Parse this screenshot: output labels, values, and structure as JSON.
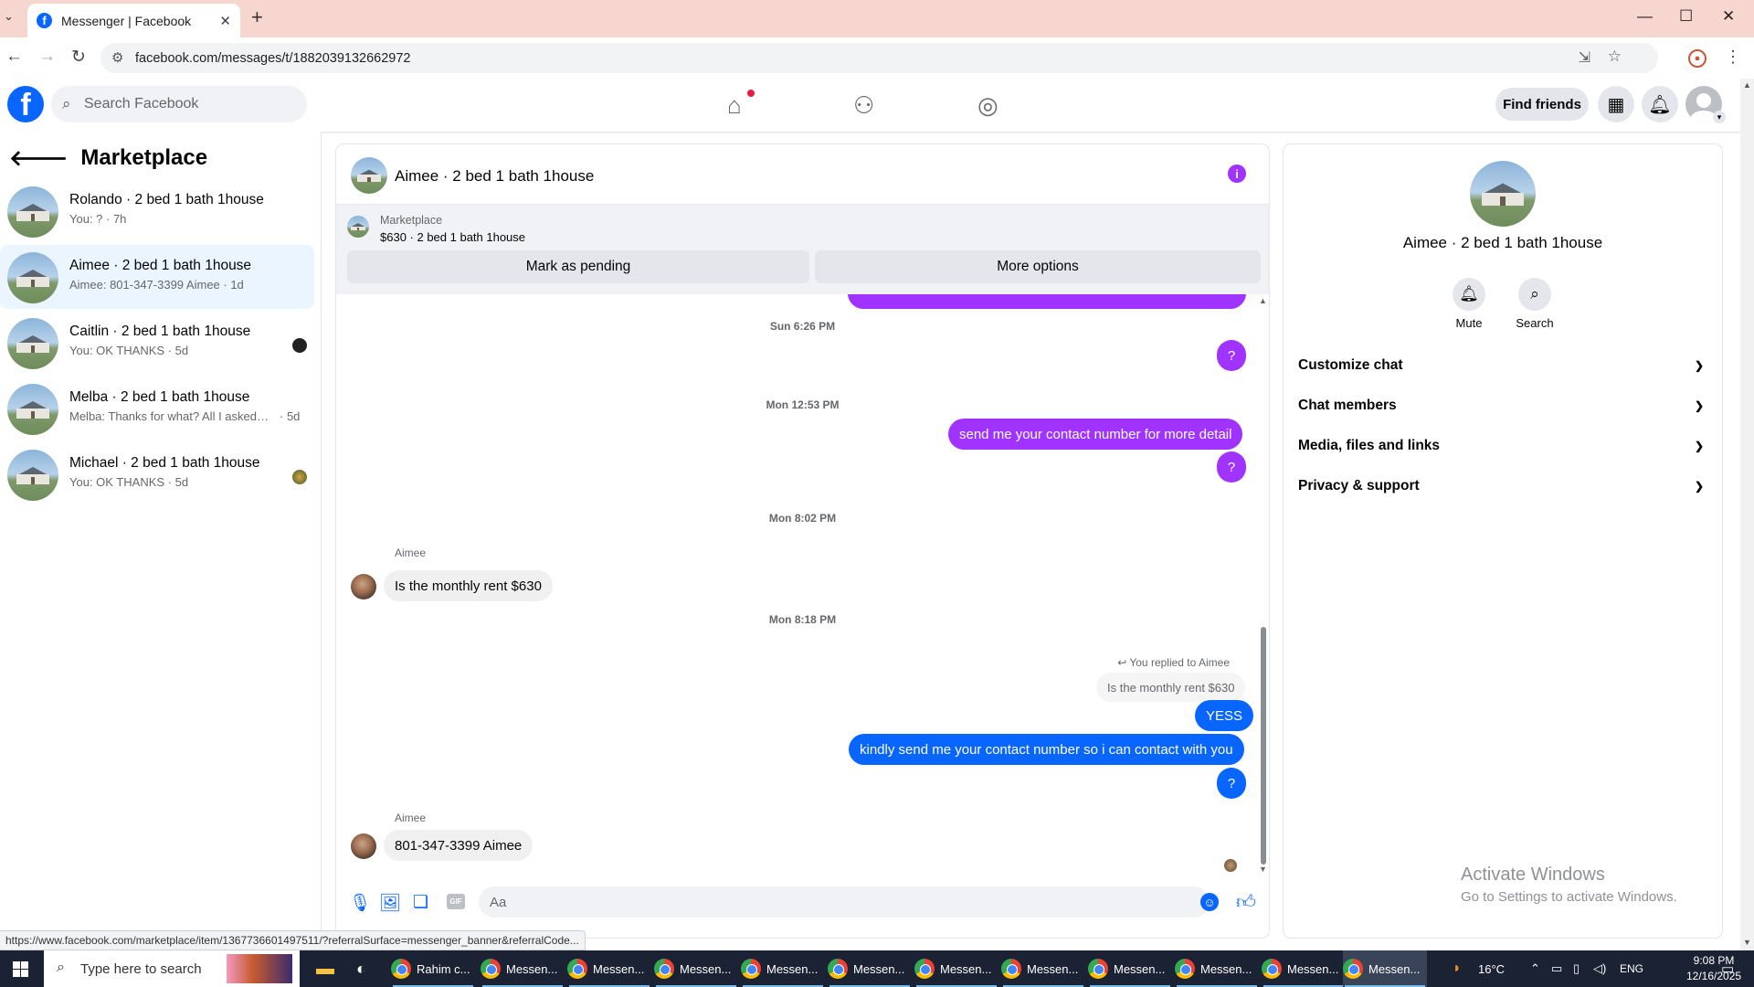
{
  "browser": {
    "tab_title": "Messenger | Facebook",
    "url": "facebook.com/messages/t/1882039132662972"
  },
  "fb_header": {
    "search_placeholder": "Search Facebook",
    "find_friends": "Find friends"
  },
  "left": {
    "title": "Marketplace",
    "conversations": [
      {
        "name": "Rolando · 2 bed 1 bath 1house",
        "preview": "You: ? · 7h"
      },
      {
        "name": "Aimee · 2 bed 1 bath 1house",
        "preview": "Aimee: 801-347-3399 Aimee · 1d"
      },
      {
        "name": "Caitlin · 2 bed 1 bath 1house",
        "preview": "You: OK THANKS · 5d"
      },
      {
        "name": "Melba · 2 bed 1 bath 1house",
        "preview": "Melba: Thanks for what? All I asked w...",
        "time": "· 5d"
      },
      {
        "name": "Michael · 2 bed 1 bath 1house",
        "preview": "You: OK THANKS · 5d"
      }
    ]
  },
  "chat": {
    "title": "Aimee · 2 bed 1 bath 1house",
    "banner_label": "Marketplace",
    "banner_listing": "$630 · 2 bed 1 bath 1house",
    "mark_pending": "Mark as pending",
    "more_options": "More options",
    "ts1": "Sun 6:26 PM",
    "msg_q1": "?",
    "ts2": "Mon 12:53 PM",
    "msg_contact": "send me your contact number for more detail",
    "msg_q2": "?",
    "ts3": "Mon 8:02 PM",
    "sender1": "Aimee",
    "msg_rent": "Is the monthly rent $630",
    "ts4": "Mon 8:18 PM",
    "replied_to": "You replied to Aimee",
    "quote": "Is the monthly rent $630",
    "msg_yess": "YESS",
    "msg_kindly": "kindly send me your contact number so i can contact with you",
    "msg_q3": "?",
    "sender2": "Aimee",
    "msg_phone": "801-347-3399 Aimee",
    "composer_placeholder": "Aa",
    "gif": "GIF"
  },
  "right": {
    "name": "Aimee · 2 bed 1 bath 1house",
    "mute": "Mute",
    "search": "Search",
    "sections": [
      "Customize chat",
      "Chat members",
      "Media, files and links",
      "Privacy & support"
    ]
  },
  "watermark": {
    "line1": "Activate Windows",
    "line2": "Go to Settings to activate Windows."
  },
  "status_url": "https://www.facebook.com/marketplace/item/1367736601497511/?referralSurface=messenger_banner&referralCode...",
  "taskbar": {
    "search_placeholder": "Type here to search",
    "apps": [
      "Rahim c...",
      "Messen...",
      "Messen...",
      "Messen...",
      "Messen...",
      "Messen...",
      "Messen...",
      "Messen...",
      "Messen...",
      "Messen...",
      "Messen...",
      "Messen..."
    ],
    "temp": "16°C",
    "lang": "ENG",
    "time": "9:08 PM",
    "date": "12/16/2025"
  }
}
